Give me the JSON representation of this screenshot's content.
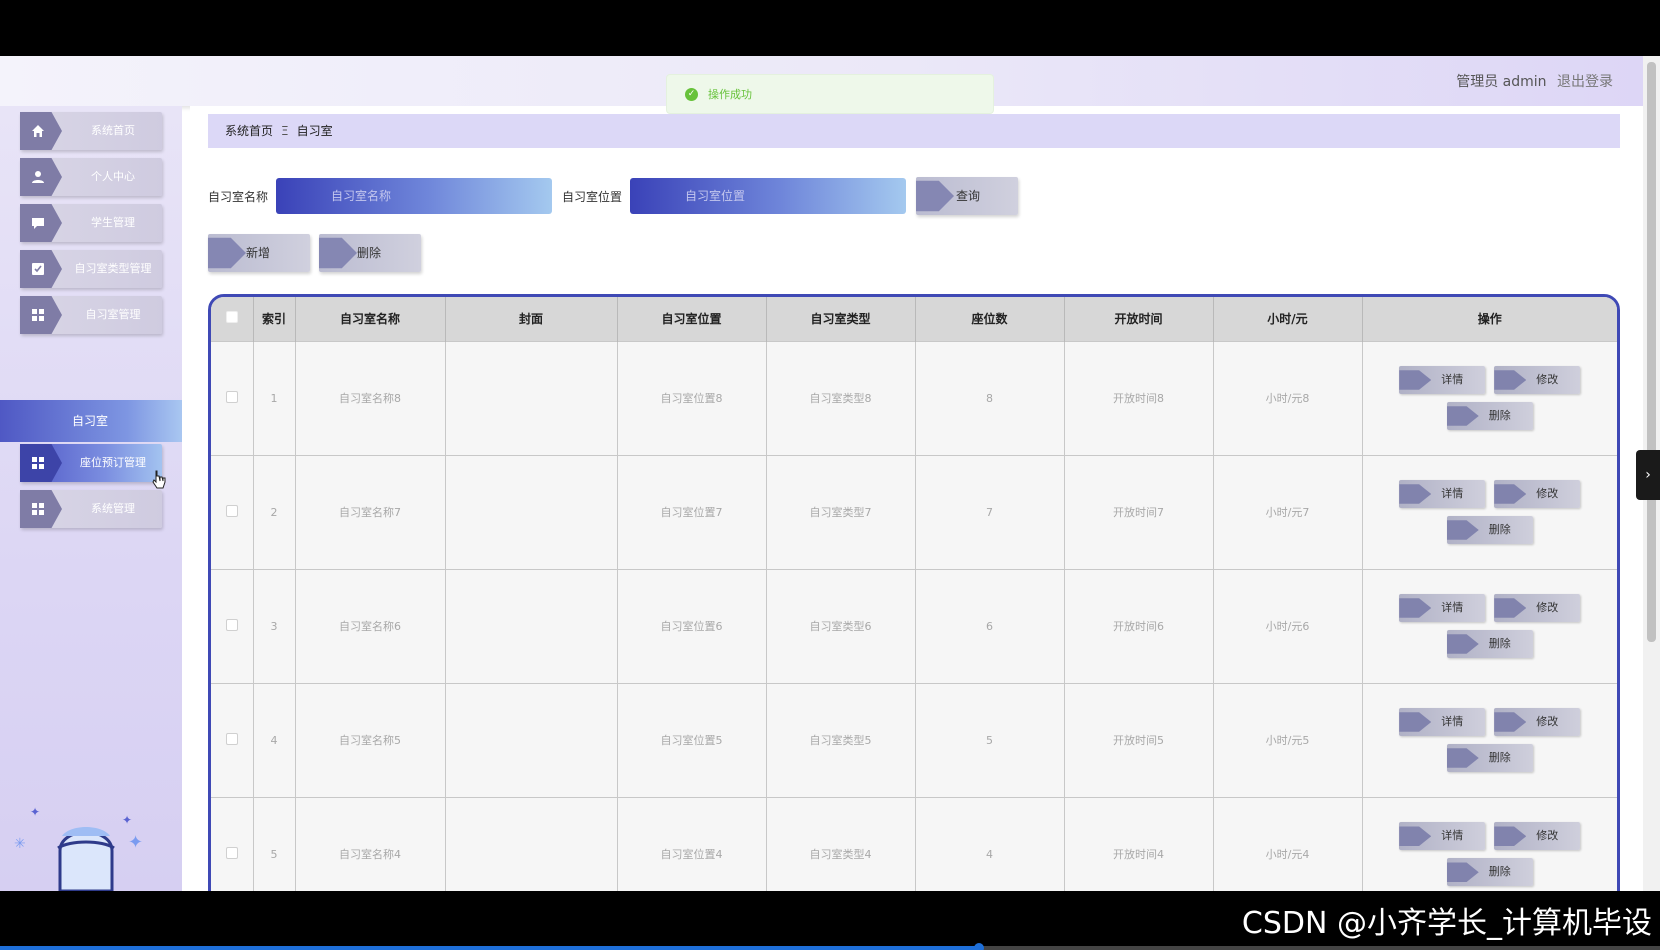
{
  "header": {
    "user_label": "管理员 admin",
    "logout_label": "退出登录"
  },
  "toast": {
    "text": "操作成功"
  },
  "sidebar": {
    "items": [
      {
        "label": "系统首页",
        "icon": "home-icon"
      },
      {
        "label": "个人中心",
        "icon": "user-icon"
      },
      {
        "label": "学生管理",
        "icon": "chat-icon"
      },
      {
        "label": "自习室类型管理",
        "icon": "check-icon"
      },
      {
        "label": "自习室管理",
        "icon": "grid-icon"
      },
      {
        "label": "座位预订管理",
        "icon": "grid-icon"
      },
      {
        "label": "系统管理",
        "icon": "grid-icon"
      }
    ],
    "sub_item": "自习室"
  },
  "breadcrumb": {
    "home": "系统首页",
    "separator": "Ξ",
    "current": "自习室"
  },
  "search": {
    "name_label": "自习室名称",
    "name_placeholder": "自习室名称",
    "location_label": "自习室位置",
    "location_placeholder": "自习室位置",
    "query_button": "查询"
  },
  "actions": {
    "add": "新增",
    "delete": "删除"
  },
  "table": {
    "headers": [
      "索引",
      "自习室名称",
      "封面",
      "自习室位置",
      "自习室类型",
      "座位数",
      "开放时间",
      "小时/元",
      "操作"
    ],
    "rows": [
      {
        "index": "1",
        "name": "自习室名称8",
        "cover": "",
        "location": "自习室位置8",
        "type": "自习室类型8",
        "seats": "8",
        "open": "开放时间8",
        "price": "小时/元8"
      },
      {
        "index": "2",
        "name": "自习室名称7",
        "cover": "",
        "location": "自习室位置7",
        "type": "自习室类型7",
        "seats": "7",
        "open": "开放时间7",
        "price": "小时/元7"
      },
      {
        "index": "3",
        "name": "自习室名称6",
        "cover": "",
        "location": "自习室位置6",
        "type": "自习室类型6",
        "seats": "6",
        "open": "开放时间6",
        "price": "小时/元6"
      },
      {
        "index": "4",
        "name": "自习室名称5",
        "cover": "",
        "location": "自习室位置5",
        "type": "自习室类型5",
        "seats": "5",
        "open": "开放时间5",
        "price": "小时/元5"
      },
      {
        "index": "5",
        "name": "自习室名称4",
        "cover": "",
        "location": "自习室位置4",
        "type": "自习室类型4",
        "seats": "4",
        "open": "开放时间4",
        "price": "小时/元4"
      }
    ],
    "row_buttons": {
      "detail": "详情",
      "edit": "修改",
      "delete": "删除"
    }
  },
  "watermark": "CSDN @小齐学长_计算机毕设",
  "video": {
    "progress": 0.59
  },
  "colors": {
    "accent": "#3f49b5",
    "success": "#67c23a",
    "sidebar_bg": "#dcd6f4"
  }
}
